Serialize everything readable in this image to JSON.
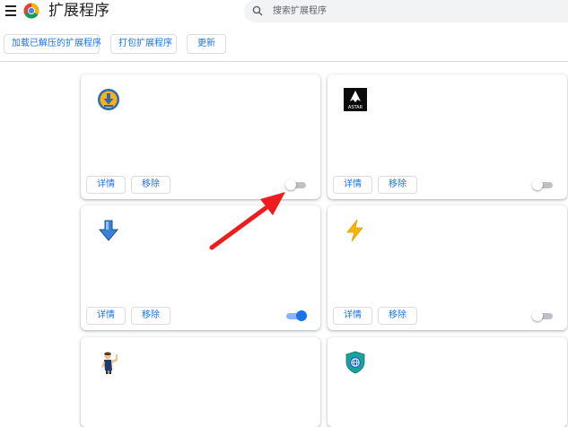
{
  "header": {
    "title": "扩展程序",
    "menu_icon": "hamburger-menu-icon",
    "logo_icon": "chrome-logo-icon",
    "search_placeholder": "搜索扩展程序",
    "search_icon": "search-icon"
  },
  "toolbar": {
    "load_unpacked": "加载已解压的扩展程序",
    "pack_extension": "打包扩展程序",
    "update": "更新"
  },
  "card_buttons": {
    "details": "详情",
    "remove": "移除"
  },
  "cards": [
    {
      "icon": "download-arrow-icon",
      "enabled": false
    },
    {
      "icon": "astar-logo-icon",
      "icon_text": "ASTAR",
      "enabled": false
    },
    {
      "icon": "blue-down-arrow-icon",
      "enabled": true
    },
    {
      "icon": "lightning-bolt-icon",
      "enabled": false
    },
    {
      "icon": "flexing-character-icon"
    },
    {
      "icon": "shield-globe-icon"
    }
  ],
  "annotation": {
    "icon": "red-arrow-annotation",
    "color": "#ee1c1c"
  },
  "colors": {
    "accent": "#1a73e8",
    "toggle_on_track": "#8ab4f8",
    "toggle_off_track": "#bdc1c6"
  }
}
